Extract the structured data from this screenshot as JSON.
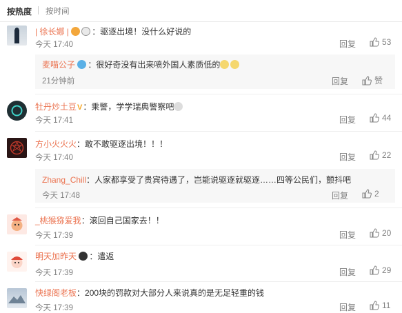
{
  "sort": {
    "hot": "按热度",
    "time": "按时间"
  },
  "actions": {
    "reply": "回复",
    "like": "赞"
  },
  "comments": [
    {
      "user": "| 徐长娜 |",
      "text": "：驱逐出境！没什么好说的",
      "time": "今天 17:40",
      "likes": "53"
    },
    {
      "user": "麦喵公子",
      "text": "：很好奇没有出来喷外国人素质低的",
      "time": "21分钟前",
      "likes": ""
    },
    {
      "user": "牡丹炒土豆",
      "text": "：乘警，学学瑞典警察吧",
      "time": "今天 17:41",
      "likes": "44"
    },
    {
      "user": "方小火火火",
      "text": "：敢不敢驱逐出境！！！",
      "time": "今天 17:40",
      "likes": "22"
    },
    {
      "user": "Zhang_Chill",
      "text": "：人家都享受了贵宾待遇了，岂能说驱逐就驱逐……四等公民们，颤抖吧",
      "time": "今天 17:48",
      "likes": "2"
    },
    {
      "user": "_桃猴猕爱我",
      "text": "：滚回自己国家去！！",
      "time": "今天 17:39",
      "likes": "20"
    },
    {
      "user": "明天加昨天",
      "text": "：遣返",
      "time": "今天 17:39",
      "likes": "29"
    },
    {
      "user": "快绿阁老板",
      "text": "：200块的罚款对大部分人来说真的是无足轻重的钱",
      "time": "今天 17:39",
      "likes": "11"
    }
  ]
}
